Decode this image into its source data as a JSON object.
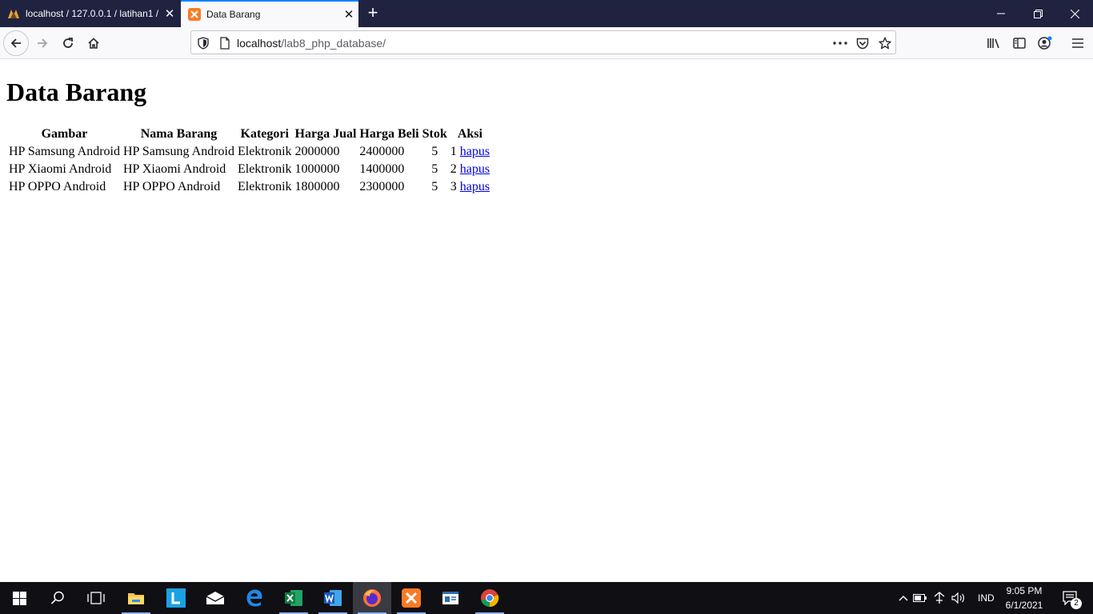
{
  "browser": {
    "tabs": [
      {
        "title": "localhost / 127.0.0.1 / latihan1 /",
        "icon": "phpmyadmin-icon"
      },
      {
        "title": "Data Barang",
        "icon": "xampp-icon",
        "active": true
      }
    ],
    "url": {
      "host": "localhost",
      "path": "/lab8_php_database/"
    }
  },
  "page": {
    "heading": "Data Barang",
    "table": {
      "headers": {
        "gambar": "Gambar",
        "nama": "Nama Barang",
        "kategori": "Kategori",
        "jual": "Harga Jual",
        "beli": "Harga Beli",
        "stok": "Stok",
        "aksi": "Aksi"
      },
      "rows": [
        {
          "gambar": "HP Samsung Android",
          "nama": "HP Samsung Android",
          "kategori": "Elektronik",
          "jual": "2000000",
          "beli": "2400000",
          "stok": "5",
          "id": "1",
          "action": "hapus"
        },
        {
          "gambar": "HP Xiaomi Android",
          "nama": "HP Xiaomi Android",
          "kategori": "Elektronik",
          "jual": "1000000",
          "beli": "1400000",
          "stok": "5",
          "id": "2",
          "action": "hapus"
        },
        {
          "gambar": "HP OPPO Android",
          "nama": "HP OPPO Android",
          "kategori": "Elektronik",
          "jual": "1800000",
          "beli": "2300000",
          "stok": "5",
          "id": "3",
          "action": "hapus"
        }
      ]
    }
  },
  "taskbar": {
    "apps": [
      "start-icon",
      "search-icon",
      "task-view-icon",
      "file-explorer-icon",
      "app-l-icon",
      "mail-icon",
      "edge-icon",
      "excel-icon",
      "word-icon",
      "firefox-icon",
      "xampp-icon",
      "app-window-icon",
      "chrome-icon"
    ],
    "language": "IND",
    "time": "9:05 PM",
    "date": "6/1/2021",
    "notification_count": "2"
  },
  "colors": {
    "tabbar": "#1f2340",
    "accent": "#0a84ff",
    "link": "#0000ee",
    "taskbar": "#0f0f14"
  }
}
